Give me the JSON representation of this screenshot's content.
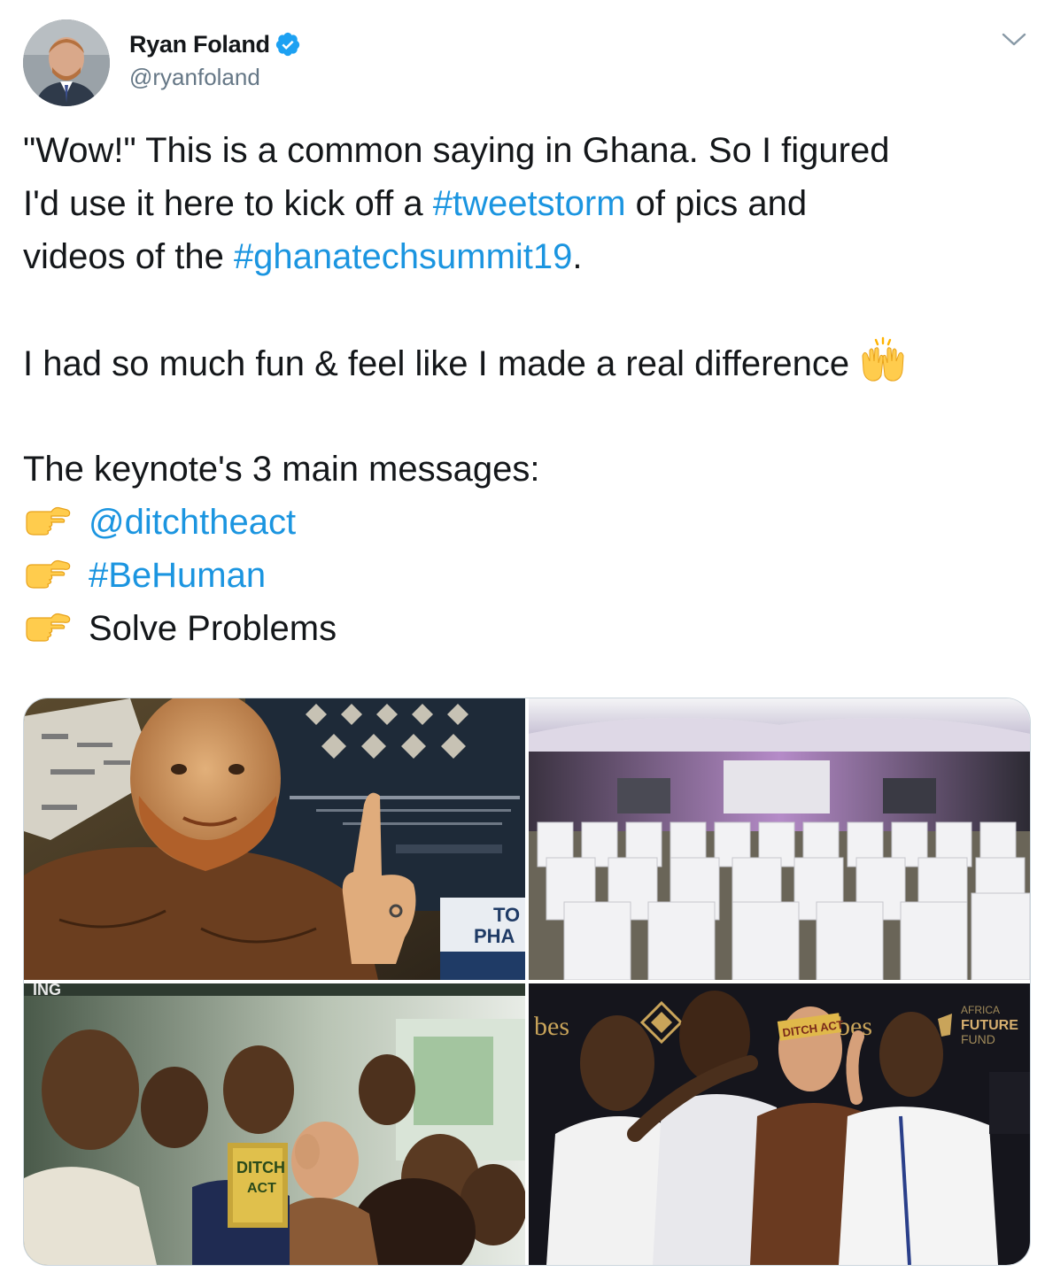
{
  "author": {
    "display_name": "Ryan Foland",
    "handle": "@ryanfoland",
    "verified": true,
    "avatar_icon": "profile-photo"
  },
  "menu": {
    "icon": "chevron-down-icon"
  },
  "tweet": {
    "line1": "\"Wow!\" This is a common saying in Ghana. So I figured",
    "line2_before": "I'd use it here to kick off a ",
    "hashtag_tweetstorm": "#tweetstorm",
    "line2_after": " of pics and",
    "line3_before": "videos of the ",
    "hashtag_summit": "#ghanatechsummit19",
    "line3_after": ".",
    "line4": "I had so much fun & feel like I made a real difference ",
    "line4_emoji": "raising-hands-emoji",
    "line5": "The keynote's 3 main messages:",
    "points": [
      {
        "emoji": "pointing-right-emoji",
        "text": "@ditchtheact",
        "is_link": true
      },
      {
        "emoji": "pointing-right-emoji",
        "text": "#BeHuman",
        "is_link": true
      },
      {
        "emoji": "pointing-right-emoji",
        "text": "Solve Problems",
        "is_link": false
      }
    ]
  },
  "media": {
    "photos": [
      {
        "name": "photo-selfie-pointing",
        "sign_text_1": "TO",
        "sign_text_2": "PHA"
      },
      {
        "name": "photo-empty-event-tent"
      },
      {
        "name": "photo-group-selfie-book",
        "book_text_1": "DITCH",
        "book_text_2": "ACT",
        "banner_text": "ING"
      },
      {
        "name": "photo-group-pointing",
        "backdrop_text_1": "bes",
        "backdrop_text_2": "bes",
        "backdrop_text_3": "FUTURE",
        "backdrop_text_4": "FUND",
        "backdrop_text_5": "AFRICA",
        "cap_text": "DITCH ACT"
      }
    ]
  },
  "colors": {
    "link": "#1b95e0",
    "text": "#14171a",
    "secondary": "#657786",
    "verified": "#1da1f2"
  }
}
